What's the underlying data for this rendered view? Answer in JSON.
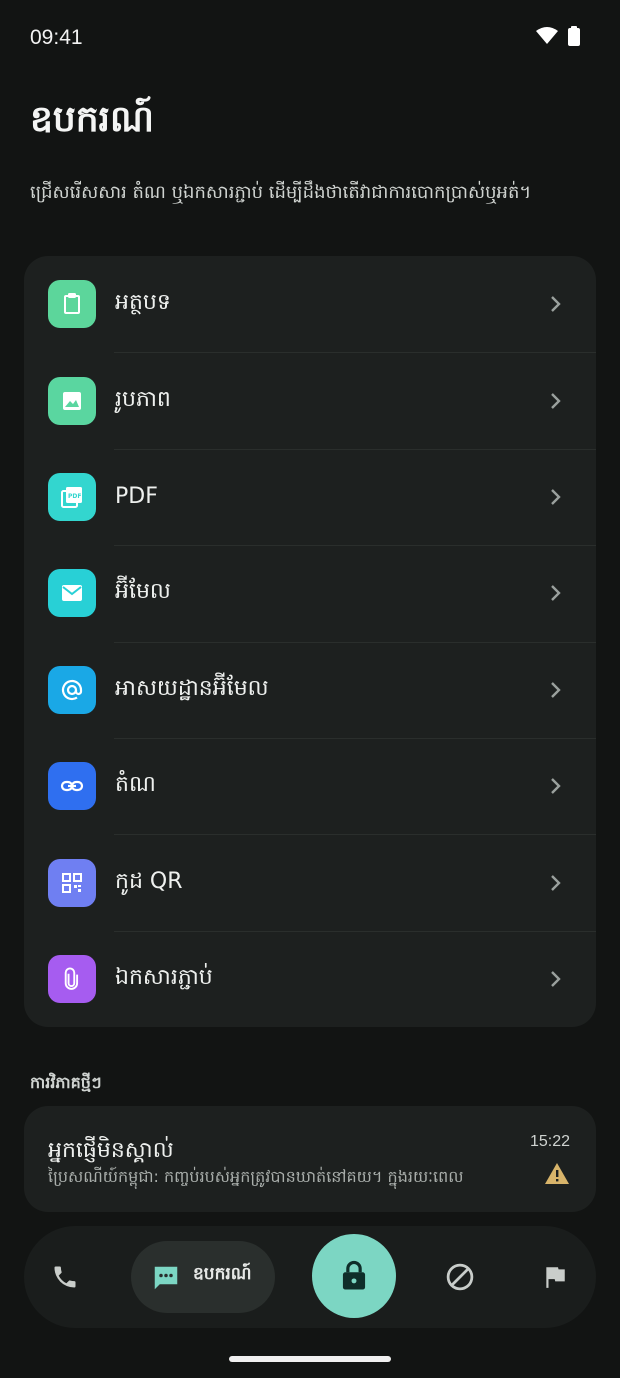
{
  "status_bar": {
    "time": "09:41",
    "wifi_icon": "wifi-icon",
    "battery_icon": "battery-icon"
  },
  "header": {
    "title": "ឧបករណ៍",
    "subtitle": "ជ្រើសរើសសារ តំណ ឬឯកសារភ្ជាប់ ដើម្បីដឹងថាតើវាជាការបោកប្រាស់ឬអត់។"
  },
  "tools": [
    {
      "label": "អត្ថបទ",
      "icon": "clipboard-icon",
      "color": "#5cd69b"
    },
    {
      "label": "រូបភាព",
      "icon": "image-icon",
      "color": "#5ad6a0"
    },
    {
      "label": "PDF",
      "icon": "pdf-icon",
      "color": "#33d6cf"
    },
    {
      "label": "អ៊ីមែល",
      "icon": "mail-icon",
      "color": "#28d0d6"
    },
    {
      "label": "អាសយដ្ឋានអ៊ីមែល",
      "icon": "at-sign-icon",
      "color": "#1aa8e6"
    },
    {
      "label": "តំណ",
      "icon": "link-icon",
      "color": "#2f6ff0"
    },
    {
      "label": "កូដ QR",
      "icon": "qr-code-icon",
      "color": "#6f7ff2"
    },
    {
      "label": "ឯកសារភ្ជាប់",
      "icon": "paperclip-icon",
      "color": "#a65cf0"
    }
  ],
  "recent": {
    "section_title": "ការវិភាគថ្មីៗ",
    "item": {
      "sender": "អ្នកផ្ញើមិនស្គាល់",
      "time": "15:22",
      "preview": "ប្រៃសណីយ៍កម្ពុជា: កញ្ចប់របស់អ្នកត្រូវបានឃាត់នៅគយ។ ក្នុងរយៈពេល",
      "status_icon": "warning-icon",
      "status_color": "#d8b46a"
    }
  },
  "nav": {
    "phone_icon": "phone-icon",
    "tools_label": "ឧបករណ៍",
    "tools_icon": "message-icon",
    "center_icon": "lock-icon",
    "center_color": "#7cd6c3",
    "block_icon": "block-icon",
    "flag_icon": "flag-icon"
  }
}
